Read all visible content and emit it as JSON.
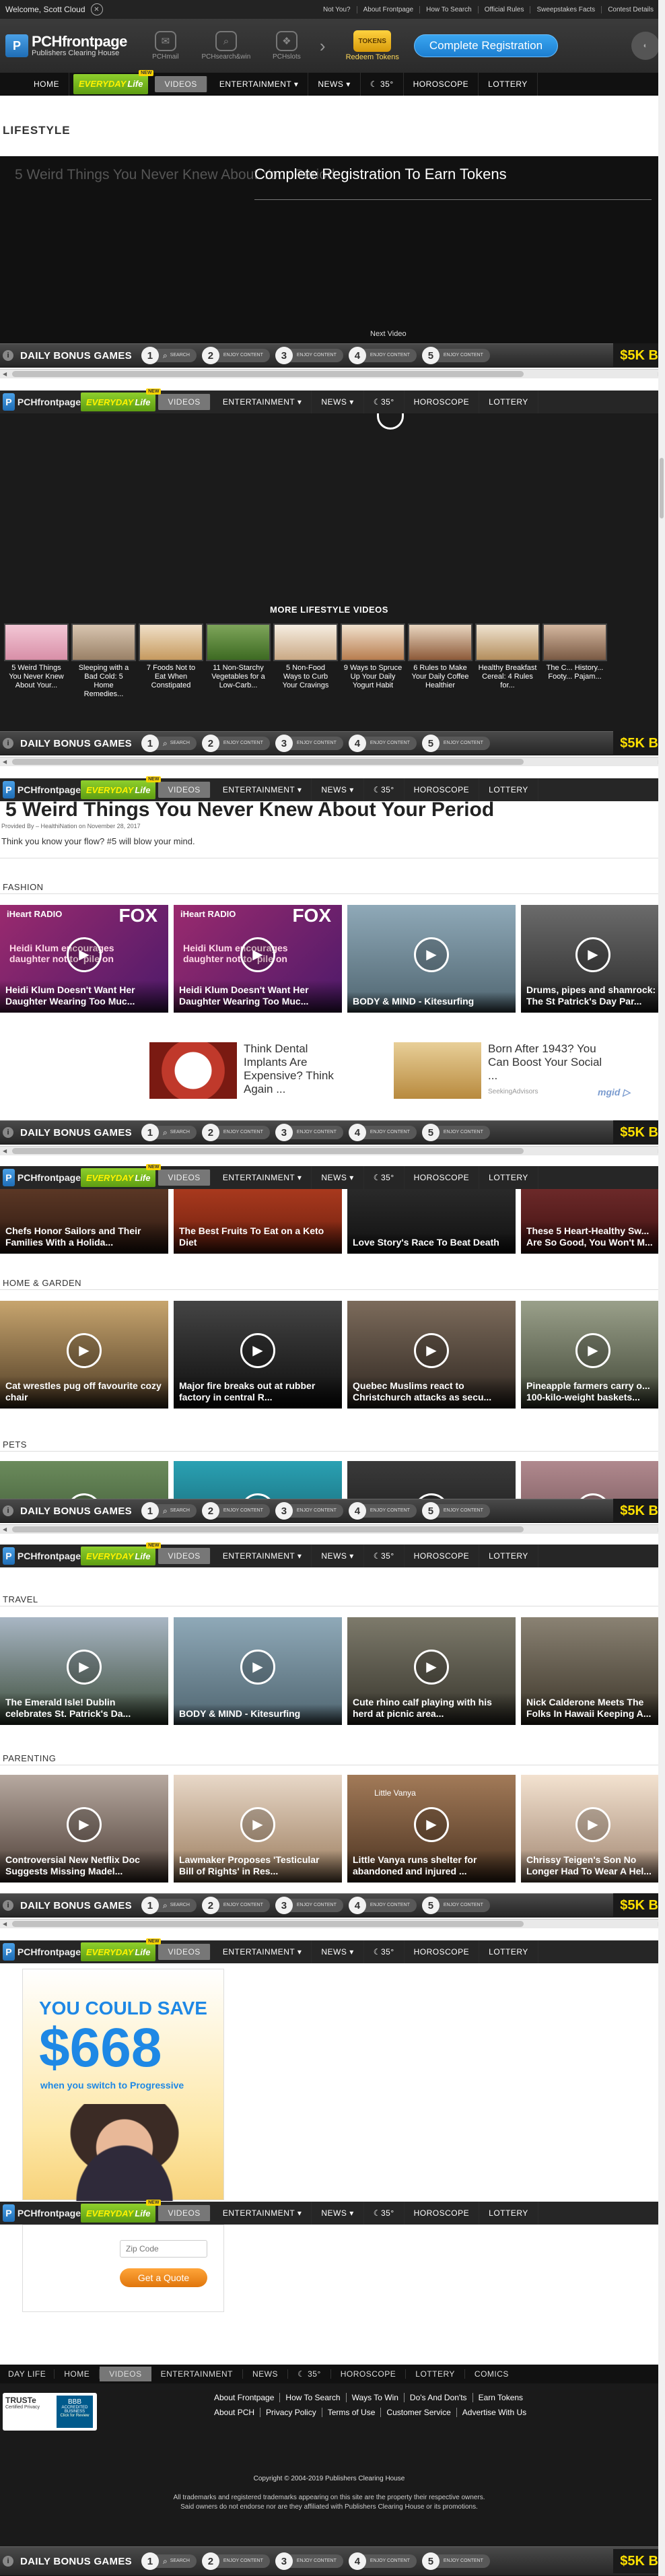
{
  "topbar": {
    "welcome": "Welcome, Scott Cloud",
    "links": [
      "Not You?",
      "About Frontpage",
      "How To Search",
      "Official Rules",
      "Sweepstakes Facts",
      "Contest Details"
    ]
  },
  "header": {
    "logo_main": "PCHfrontpage",
    "logo_sub": "Publishers Clearing House",
    "navicons": [
      {
        "label": "PCHmail",
        "icon": "envelope-icon"
      },
      {
        "label": "PCHsearch&win",
        "icon": "search-icon"
      },
      {
        "label": "PCHslots",
        "icon": "slots-icon"
      }
    ],
    "redeem_label": "Redeem Tokens",
    "redeem_coin": "TOKENS",
    "register_button": "Complete Registration"
  },
  "nav": {
    "items": [
      "HOME",
      "ENTERTAINMENT ▾",
      "NEWS ▾",
      "HOROSCOPE",
      "LOTTERY"
    ],
    "everyday_1": "EVERYDAY",
    "everyday_2": "Life",
    "new_tag": "NEW",
    "videos": "VIDEOS",
    "temperature": "35°"
  },
  "section_lifestyle": "LIFESTYLE",
  "player": {
    "dimmed_title": "5 Weird Things You Never Knew About Your Period",
    "overlay_title": "Complete Registration To Earn Tokens",
    "next_video": "Next Video"
  },
  "bonus": {
    "label": "DAILY BONUS GAMES",
    "steps": [
      {
        "num": "1",
        "text": "SEARCH"
      },
      {
        "num": "2",
        "text": "ENJOY CONTENT"
      },
      {
        "num": "3",
        "text": "ENJOY CONTENT"
      },
      {
        "num": "4",
        "text": "ENJOY CONTENT"
      },
      {
        "num": "5",
        "text": "ENJOY CONTENT"
      }
    ],
    "money": "$5K B"
  },
  "more_lifestyle": {
    "title": "MORE LIFESTYLE VIDEOS",
    "items": [
      "5 Weird Things You Never Knew About Your...",
      "Sleeping with a Bad Cold: 5 Home Remedies...",
      "7 Foods Not to Eat When Constipated",
      "11 Non-Starchy Vegetables for a Low-Carb...",
      "5 Non-Food Ways to Curb Your Cravings",
      "9 Ways to Spruce Up Your Daily Yogurt Habit",
      "6 Rules to Make Your Daily Coffee Healthier",
      "Healthy Breakfast Cereal: 4 Rules for...",
      "The C... History... Footy... Pajam..."
    ]
  },
  "article": {
    "title": "5 Weird Things You Never Knew About Your Period",
    "meta": "Provided By – HealthiNation on November 28, 2017",
    "blurb": "Think you know your flow? #5 will blow your mind."
  },
  "fashion": {
    "heading": "FASHION",
    "cards": [
      "Heidi Klum Doesn't Want Her Daughter Wearing Too Muc...",
      "Heidi Klum Doesn't Want Her Daughter Wearing Too Muc...",
      "BODY & MIND - Kitesurfing",
      "Drums, pipes and shamrock: The St Patrick's Day Par..."
    ],
    "radio": "iHeart RADIO",
    "fox": "FOX",
    "card_overlay": "Heidi Klum encourages daughter not to 'pile on"
  },
  "ads": {
    "ad1": "Think Dental Implants Are Expensive? Think Again ...",
    "ad2": "Born After 1943? You Can Boost Your Social ...",
    "ad2_source": "SeekingAdvisors",
    "mgid": "mgid ▷"
  },
  "food": {
    "cards": [
      "Chefs Honor Sailors and Their Families With a Holida...",
      "The Best Fruits To Eat on a Keto Diet",
      "Love Story's Race To Beat Death",
      "These 5 Heart-Healthy Sw... Are So Good, You Won't M..."
    ]
  },
  "homegarden": {
    "heading": "HOME & GARDEN",
    "cards": [
      "Cat wrestles pug off favourite cozy chair",
      "Major fire breaks out at rubber factory in central R...",
      "Quebec Muslims react to Christchurch attacks as secu...",
      "Pineapple farmers carry o... 100-kilo-weight baskets..."
    ]
  },
  "pets": {
    "heading": "PETS"
  },
  "travel": {
    "heading": "TRAVEL",
    "cards": [
      "The Emerald Isle! Dublin celebrates St. Patrick's Da...",
      "BODY & MIND - Kitesurfing",
      "Cute rhino calf playing with his herd at picnic area...",
      "Nick Calderone Meets The Folks In Hawaii Keeping A..."
    ]
  },
  "parenting": {
    "heading": "PARENTING",
    "cards": [
      "Controversial New Netflix Doc Suggests Missing Madel...",
      "Lawmaker Proposes 'Testicular Bill of Rights' in Res...",
      "Little Vanya runs shelter for abandoned and injured ...",
      "Chrissy Teigen's Son No Longer Had To Wear A Hel..."
    ],
    "dog_caption": "Little Vanya"
  },
  "progressive": {
    "line1": "YOU COULD SAVE",
    "amount": "$668",
    "line2": "when you switch to Progressive",
    "zip_placeholder": "Zip Code",
    "quote_button": "Get a Quote"
  },
  "footer": {
    "nav": [
      "DAY LIFE",
      "HOME",
      "VIDEOS",
      "ENTERTAINMENT",
      "NEWS",
      "35°",
      "HOROSCOPE",
      "LOTTERY",
      "COMICS"
    ],
    "links_row1": [
      "About Frontpage",
      "How To Search",
      "Ways To Win",
      "Do's And Don'ts",
      "Earn Tokens"
    ],
    "links_row2": [
      "About PCH",
      "Privacy Policy",
      "Terms of Use",
      "Customer Service",
      "Advertise With Us"
    ],
    "truste": "TRUSTe",
    "truste_sub": "Certified Privacy",
    "bbb": "BBB",
    "bbb_sub": "ACCREDITED BUSINESS",
    "bbb_click": "Click for Review",
    "copyright": "Copyright © 2004-2019 Publishers Clearing House",
    "trademark1": "All trademarks and registered trademarks appearing on this site are the property their respective owners.",
    "trademark2": "Said owners do not endorse nor are they affiliated with Publishers Clearing House or its promotions."
  },
  "colors": {
    "accent_blue": "#1c7ed1",
    "everyday_green": "#6aad17",
    "bonus_money": "#ffe000"
  }
}
